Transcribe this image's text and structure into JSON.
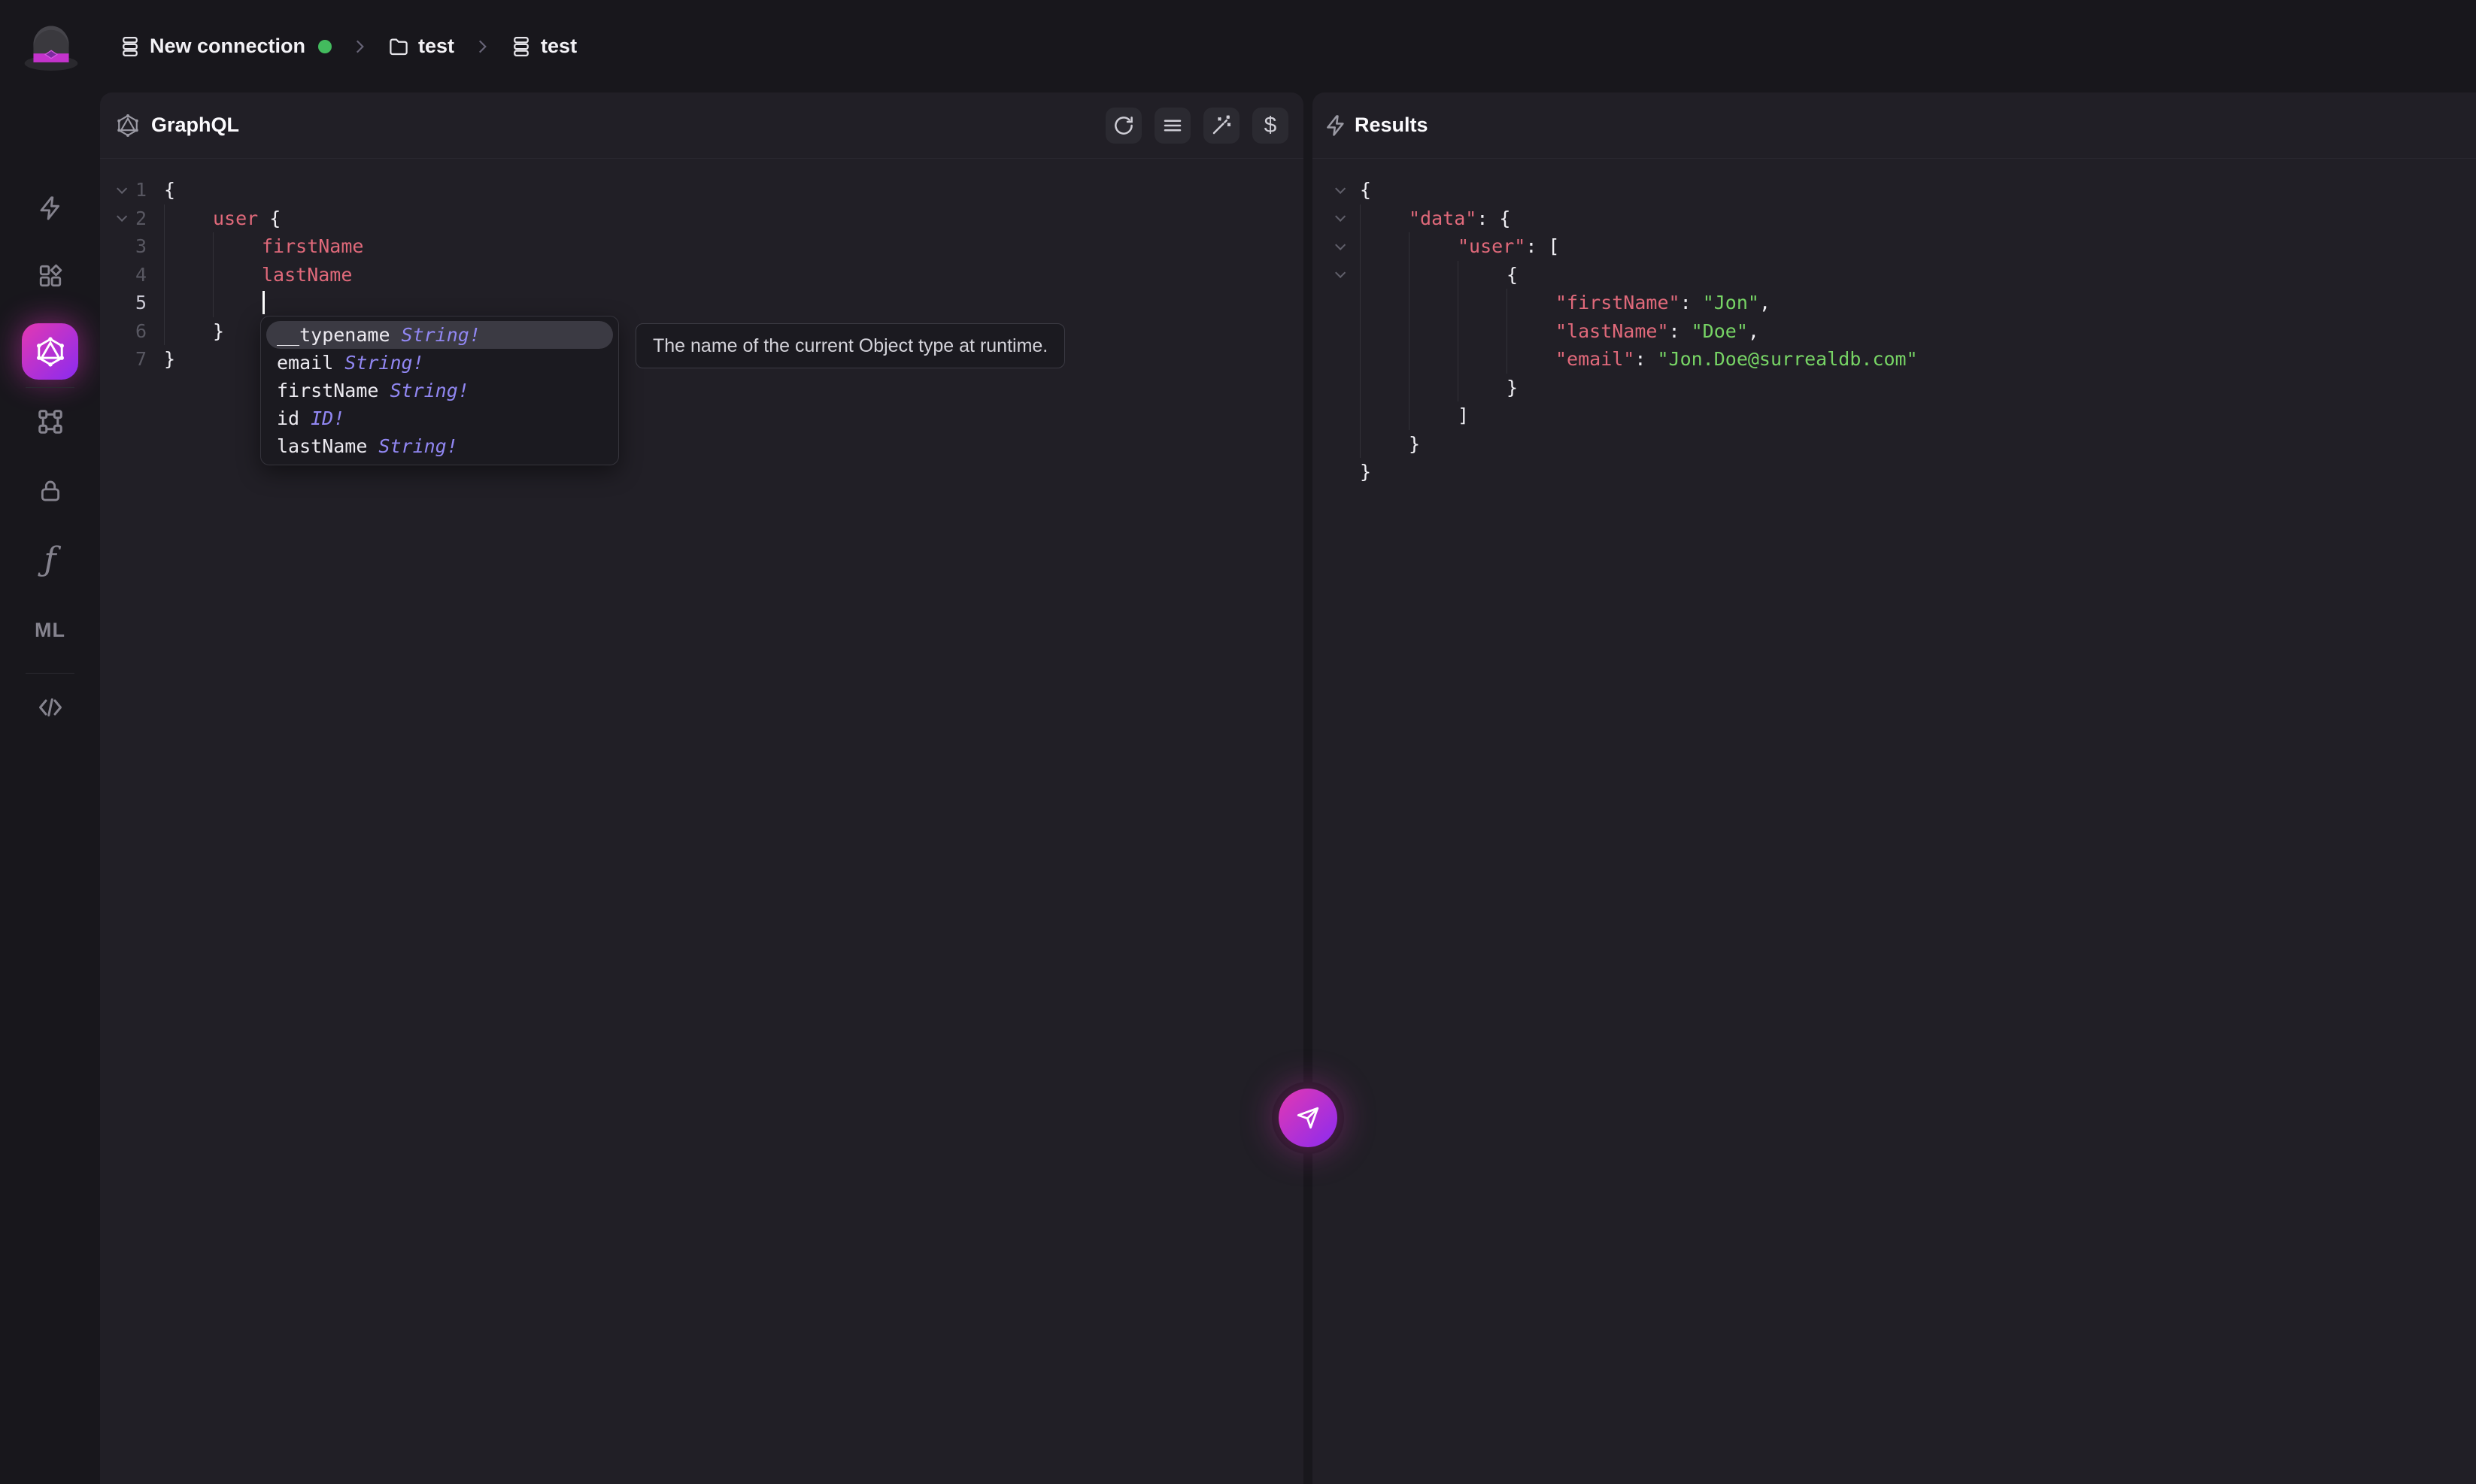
{
  "topbar": {
    "connection_label": "New connection",
    "namespace_label": "test",
    "database_label": "test",
    "status_color": "#43bb5e"
  },
  "sidebar": {
    "functions_glyph": "ƒ",
    "models_glyph": "ML",
    "active_item": "graphql",
    "accent_gradient_from": "#e338b2",
    "accent_gradient_to": "#8a2bf0"
  },
  "graphql_panel": {
    "title": "GraphQL",
    "toolbar": {
      "dollar_glyph": "$"
    },
    "editor": {
      "lines": [
        {
          "n": "1",
          "fold": true,
          "indent": 0,
          "tokens": [
            [
              "punc",
              "{"
            ]
          ]
        },
        {
          "n": "2",
          "fold": true,
          "indent": 1,
          "tokens": [
            [
              "key",
              "user"
            ],
            [
              "punc",
              " {"
            ]
          ]
        },
        {
          "n": "3",
          "fold": false,
          "indent": 2,
          "tokens": [
            [
              "key",
              "firstName"
            ]
          ]
        },
        {
          "n": "4",
          "fold": false,
          "indent": 2,
          "tokens": [
            [
              "key",
              "lastName"
            ]
          ]
        },
        {
          "n": "5",
          "fold": false,
          "indent": 2,
          "tokens": [],
          "cursor": true,
          "active": true
        },
        {
          "n": "6",
          "fold": false,
          "indent": 1,
          "tokens": [
            [
              "punc",
              "}"
            ]
          ]
        },
        {
          "n": "7",
          "fold": false,
          "indent": 0,
          "tokens": [
            [
              "punc",
              "}"
            ]
          ]
        }
      ],
      "colors": {
        "field": "#e0697a",
        "punctuation": "#f0eff4"
      }
    },
    "autocomplete": {
      "items": [
        {
          "name": "__typename",
          "type": "String!",
          "selected": true
        },
        {
          "name": "email",
          "type": "String!",
          "selected": false
        },
        {
          "name": "firstName",
          "type": "String!",
          "selected": false
        },
        {
          "name": "id",
          "type": "ID!",
          "selected": false
        },
        {
          "name": "lastName",
          "type": "String!",
          "selected": false
        }
      ],
      "type_color": "#9187f2",
      "tooltip": "The name of the current Object type at runtime."
    }
  },
  "results_panel": {
    "title": "Results",
    "lines": [
      {
        "fold": true,
        "indent": 0,
        "tokens": [
          [
            "punc",
            "{"
          ]
        ]
      },
      {
        "fold": true,
        "indent": 1,
        "tokens": [
          [
            "key",
            "\"data\""
          ],
          [
            "punc",
            ": {"
          ]
        ]
      },
      {
        "fold": true,
        "indent": 2,
        "tokens": [
          [
            "key",
            "\"user\""
          ],
          [
            "punc",
            ": ["
          ]
        ]
      },
      {
        "fold": true,
        "indent": 3,
        "tokens": [
          [
            "punc",
            "{"
          ]
        ]
      },
      {
        "fold": false,
        "indent": 4,
        "tokens": [
          [
            "key",
            "\"firstName\""
          ],
          [
            "punc",
            ": "
          ],
          [
            "str",
            "\"Jon\""
          ],
          [
            "punc",
            ","
          ]
        ]
      },
      {
        "fold": false,
        "indent": 4,
        "tokens": [
          [
            "key",
            "\"lastName\""
          ],
          [
            "punc",
            ": "
          ],
          [
            "str",
            "\"Doe\""
          ],
          [
            "punc",
            ","
          ]
        ]
      },
      {
        "fold": false,
        "indent": 4,
        "tokens": [
          [
            "key",
            "\"email\""
          ],
          [
            "punc",
            ": "
          ],
          [
            "str",
            "\"Jon.Doe@surrealdb.com\""
          ]
        ]
      },
      {
        "fold": false,
        "indent": 3,
        "tokens": [
          [
            "punc",
            "}"
          ]
        ]
      },
      {
        "fold": false,
        "indent": 2,
        "tokens": [
          [
            "punc",
            "]"
          ]
        ]
      },
      {
        "fold": false,
        "indent": 1,
        "tokens": [
          [
            "punc",
            "}"
          ]
        ]
      },
      {
        "fold": false,
        "indent": 0,
        "tokens": [
          [
            "punc",
            "}"
          ]
        ]
      }
    ],
    "result_values": {
      "firstName": "Jon",
      "lastName": "Doe",
      "email": "Jon.Doe@surrealdb.com"
    },
    "colors": {
      "key": "#e0697a",
      "string": "#77d465"
    }
  }
}
